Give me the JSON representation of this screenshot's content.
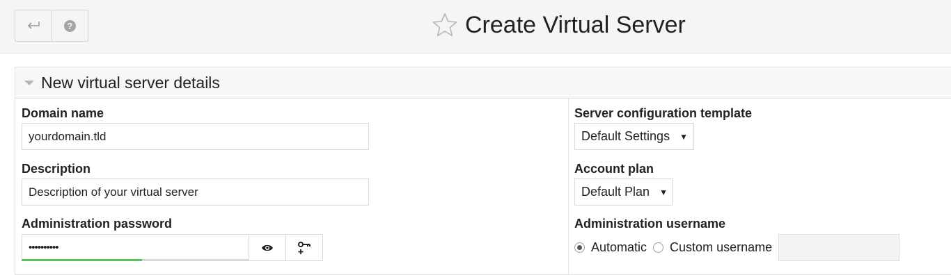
{
  "toolbar": {
    "back_icon": "return-arrow-icon",
    "help_icon": "question-circle-icon"
  },
  "header": {
    "title": "Create Virtual Server",
    "star_icon": "star-outline-icon"
  },
  "panel": {
    "title": "New virtual server details",
    "collapse_icon": "caret-down-icon"
  },
  "left": {
    "domain": {
      "label": "Domain name",
      "value": "yourdomain.tld"
    },
    "description": {
      "label": "Description",
      "value": "Description of your virtual server"
    },
    "password": {
      "label": "Administration password",
      "value": "••••••••••",
      "strength": 0.53,
      "strength_color": "#5cc35c",
      "show_icon": "eye-icon",
      "generate_icon": "key-generate-icon"
    }
  },
  "right": {
    "template": {
      "label": "Server configuration template",
      "selected": "Default Settings"
    },
    "plan": {
      "label": "Account plan",
      "selected": "Default Plan"
    },
    "username": {
      "label": "Administration username",
      "option_automatic": "Automatic",
      "option_custom": "Custom username",
      "selected": "Automatic",
      "custom_value": ""
    }
  }
}
